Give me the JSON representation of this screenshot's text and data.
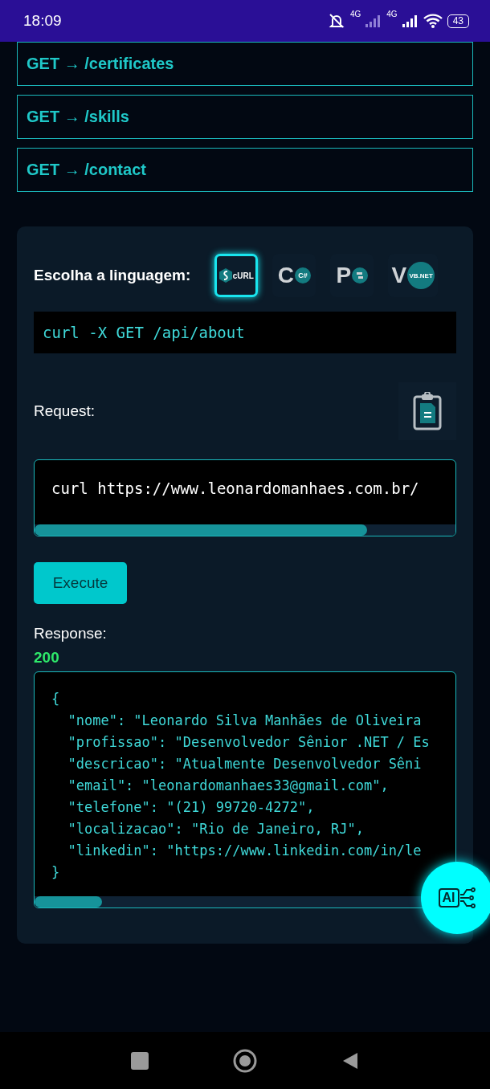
{
  "status_bar": {
    "time": "18:09",
    "network_1": "4G",
    "network_2": "4G",
    "battery": "43"
  },
  "endpoints": [
    {
      "method": "GET",
      "arrow": "→",
      "path": "/certificates"
    },
    {
      "method": "GET",
      "arrow": "→",
      "path": "/skills"
    },
    {
      "method": "GET",
      "arrow": "→",
      "path": "/contact"
    }
  ],
  "panel": {
    "language_label": "Escolha a linguagem:",
    "languages": [
      {
        "kind": "curl",
        "badge": "cURL",
        "selected": true
      },
      {
        "kind": "csharp",
        "letter": "C",
        "badge": "C#",
        "selected": false
      },
      {
        "kind": "python",
        "letter": "P",
        "selected": false
      },
      {
        "kind": "vbnet",
        "letter": "V",
        "badge": "VB.NET",
        "selected": false
      }
    ],
    "command": "curl -X GET /api/about",
    "request_label": "Request:",
    "request": "curl https://www.leonardomanhaes.com.br/",
    "execute_button": "Execute",
    "response_label": "Response:",
    "status_code": "200",
    "response_lines": [
      "{",
      "  \"nome\": \"Leonardo Silva Manhães de Oliveira",
      "  \"profissao\": \"Desenvolvedor Sênior .NET / Es",
      "  \"descricao\": \"Atualmente Desenvolvedor Sêni",
      "  \"email\": \"leonardomanhaes33@gmail.com\",",
      "  \"telefone\": \"(21) 99720-4272\",",
      "  \"localizacao\": \"Rio de Janeiro, RJ\",",
      "  \"linkedin\": \"https://www.linkedin.com/in/le",
      "}"
    ],
    "ai_button": "AI"
  }
}
